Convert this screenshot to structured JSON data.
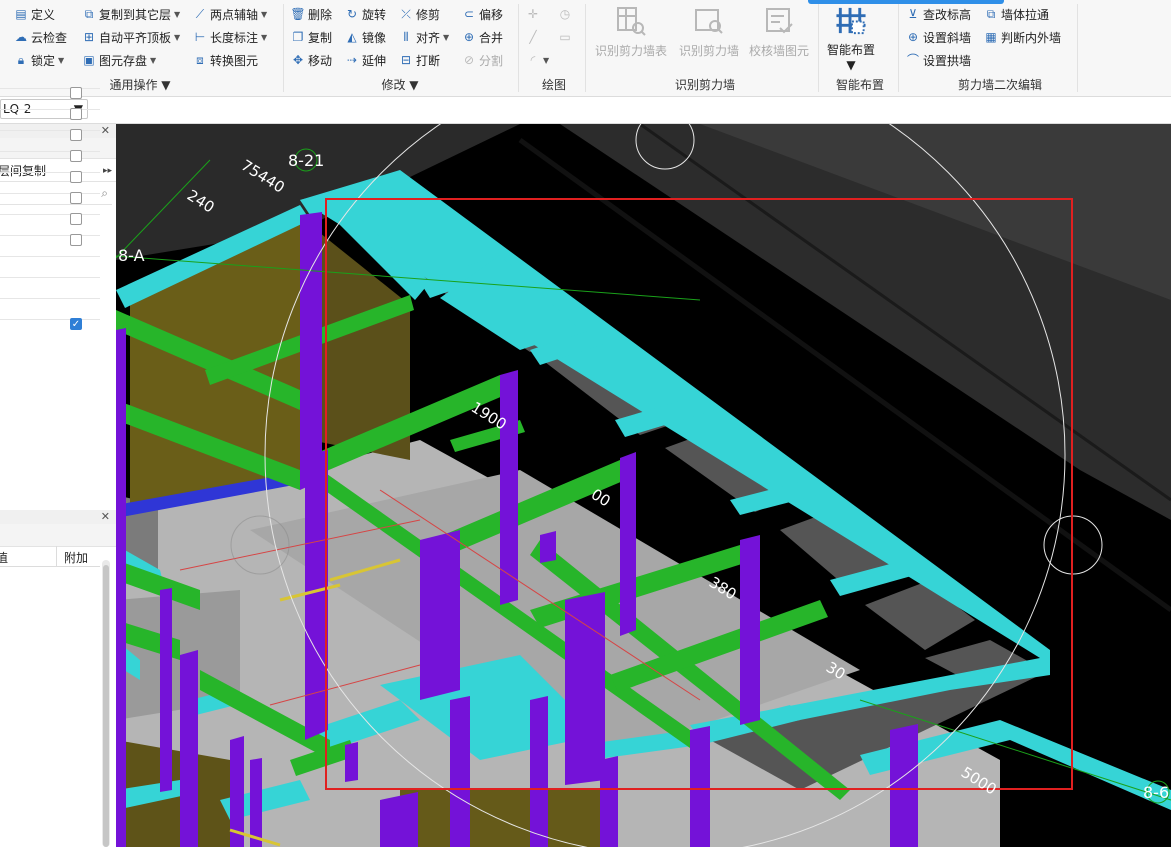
{
  "ribbon": {
    "general": {
      "items": [
        {
          "label": "定义",
          "icon": "define-icon"
        },
        {
          "label": "云检查",
          "icon": "cloud-check-icon"
        },
        {
          "label": "锁定",
          "icon": "lock-icon"
        },
        {
          "label": "复制到其它层",
          "icon": "copy-to-floor-icon"
        },
        {
          "label": "自动平齐顶板",
          "icon": "align-top-icon"
        },
        {
          "label": "图元存盘",
          "icon": "save-element-icon"
        },
        {
          "label": "两点辅轴",
          "icon": "aux-axis-icon"
        },
        {
          "label": "长度标注",
          "icon": "dimension-icon"
        },
        {
          "label": "转换图元",
          "icon": "convert-element-icon"
        }
      ],
      "group_label": "通用操作"
    },
    "modify": {
      "items": [
        {
          "label": "删除",
          "icon": "delete-icon"
        },
        {
          "label": "复制",
          "icon": "copy-icon"
        },
        {
          "label": "移动",
          "icon": "move-icon"
        },
        {
          "label": "旋转",
          "icon": "rotate-icon"
        },
        {
          "label": "镜像",
          "icon": "mirror-icon"
        },
        {
          "label": "延伸",
          "icon": "extend-icon"
        },
        {
          "label": "修剪",
          "icon": "trim-icon"
        },
        {
          "label": "对齐",
          "icon": "align-icon"
        },
        {
          "label": "打断",
          "icon": "break-icon"
        },
        {
          "label": "偏移",
          "icon": "offset-icon"
        },
        {
          "label": "合并",
          "icon": "merge-icon"
        },
        {
          "label": "分割",
          "icon": "split-icon"
        }
      ],
      "group_label": "修改"
    },
    "draw": {
      "group_label": "绘图"
    },
    "identify": {
      "buttons": [
        {
          "label": "识别剪力墙表",
          "icon": "identify-wall-table-icon"
        },
        {
          "label": "识别剪力墙",
          "icon": "identify-wall-icon"
        },
        {
          "label": "校核墙图元",
          "icon": "check-wall-icon"
        }
      ],
      "group_label": "识别剪力墙"
    },
    "smart": {
      "button_label": "智能布置",
      "group_label": "智能布置"
    },
    "secondary": {
      "items": [
        {
          "label": "查改标高",
          "icon": "elevation-icon"
        },
        {
          "label": "设置斜墙",
          "icon": "slant-wall-icon"
        },
        {
          "label": "设置拱墙",
          "icon": "arch-wall-icon"
        },
        {
          "label": "墙体拉通",
          "icon": "wall-connect-icon"
        },
        {
          "label": "判断内外墙",
          "icon": "inner-outer-wall-icon"
        }
      ],
      "group_label": "剪力墙二次编辑"
    }
  },
  "toolbar": {
    "floor_value": "LQ-2"
  },
  "left_panel": {
    "copy_between_floors": "层间复制"
  },
  "props_panel": {
    "col_value_header": "值",
    "col_attach_header": "附加",
    "checkbox_checked": [
      false,
      false,
      false,
      false,
      false,
      false,
      false,
      false,
      true
    ]
  },
  "viewport": {
    "labels": {
      "axis_8_21": "8-21",
      "axis_8_a": "8-A",
      "axis_8_6": "8-6",
      "dim_75440": "75440",
      "dim_240": "240",
      "dim_1900": "1900",
      "dim_00": "00",
      "dim_380": "380",
      "dim_30": "30",
      "dim_5000": "5000"
    }
  }
}
